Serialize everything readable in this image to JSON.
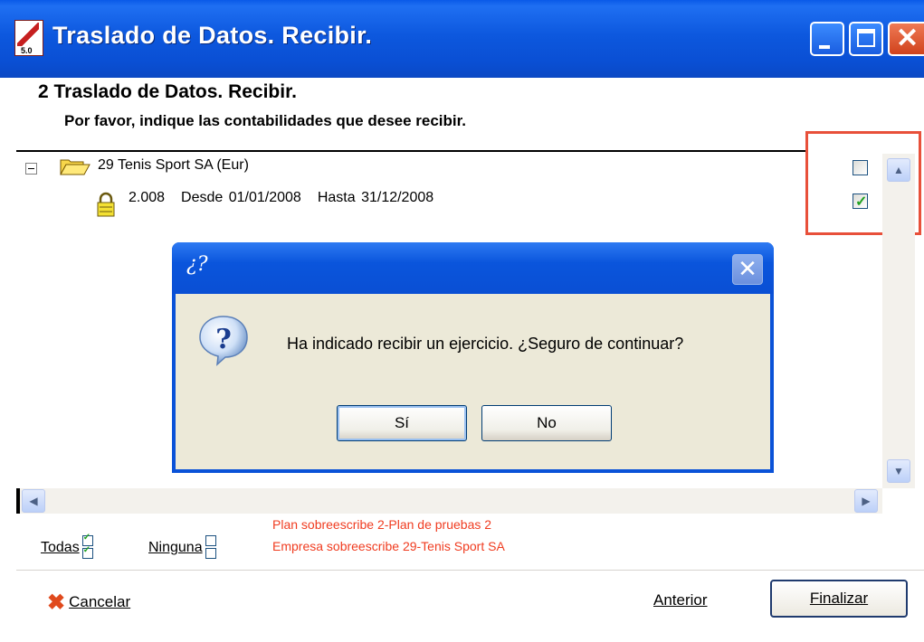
{
  "window": {
    "title": "Traslado de Datos. Recibir.",
    "app_icon_version": "5.0"
  },
  "header": {
    "title": "2 Traslado de Datos. Recibir.",
    "subtitle": "Por favor, indique las contabilidades que desee recibir."
  },
  "tree": {
    "node": {
      "label": "29 Tenis Sport SA (Eur)",
      "checked": false,
      "icon": "folder-open-icon"
    },
    "child": {
      "year": "2.008",
      "desde": "Desde 01/01/2008",
      "hasta": "Hasta 31/12/2008",
      "checked": true,
      "icon": "lock-icon"
    }
  },
  "footer": {
    "todas_label": "Todas",
    "ninguna_label": "Ninguna",
    "warning_1": "Plan sobreescribe 2-Plan de pruebas 2",
    "warning_2": "Empresa sobreescribe 29-Tenis Sport SA",
    "warning_color": "#f03c20",
    "cancel_label": "Cancelar",
    "previous_label": "Anterior",
    "finish_label": "Finalizar"
  },
  "dialog": {
    "title": "¿?",
    "message": "Ha indicado recibir un ejercicio. ¿Seguro de continuar?",
    "yes_label": "Sí",
    "no_label": "No"
  },
  "colors": {
    "titlebar": "#0a4fd4",
    "highlight_box": "#e8503a",
    "dialog_bg": "#ece9d8"
  }
}
